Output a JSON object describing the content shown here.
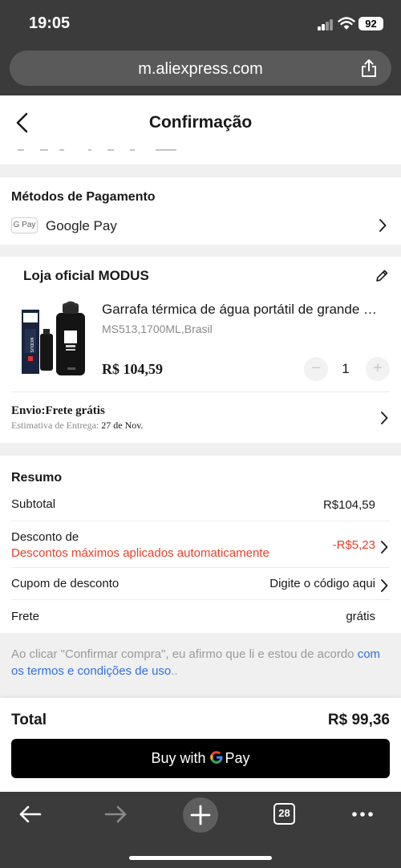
{
  "status_bar": {
    "time": "19:05",
    "battery": "92"
  },
  "browser": {
    "url": "m.aliexpress.com",
    "tabs_count": "28"
  },
  "header": {
    "title": "Confirmação"
  },
  "payment": {
    "section_title": "Métodos de Pagamento",
    "method_badge": "G Pay",
    "method": "Google Pay"
  },
  "store": {
    "name": "Loja oficial MODUS",
    "product": {
      "title": "Garrafa térmica de água portátil de grande capacidade",
      "sku": "MS513,1700ML,Brasil",
      "price": "R$ 104,59",
      "quantity": "1",
      "image_brand": "MODUS"
    },
    "shipping": {
      "title": "Envio:Frete grátis",
      "estimate_label": "Estimativa de Entrega:",
      "estimate_date": "27 de Nov."
    }
  },
  "summary": {
    "title": "Resumo",
    "subtotal_label": "Subtotal",
    "subtotal_value": "R$104,59",
    "discount_label": "Desconto de",
    "discount_note": "Descontos máximos aplicados automaticamente",
    "discount_value": "-R$5,23",
    "coupon_label": "Cupom de desconto",
    "coupon_value": "Digite o código aqui",
    "freight_label": "Frete",
    "freight_value": "grátis"
  },
  "terms": {
    "text": "Ao clicar \"Confirmar compra\", eu afirmo que li e estou de acordo ",
    "link": "com os termos e condições de uso",
    "suffix": ".."
  },
  "footer": {
    "total_label": "Total",
    "total_value": "R$ 99,36",
    "pay_button": "Buy with",
    "pay_button_brand": "Pay"
  },
  "colors": {
    "accent_red": "#e8402a",
    "link_blue": "#2f6fde",
    "chrome_dark": "#3b3b3b"
  }
}
